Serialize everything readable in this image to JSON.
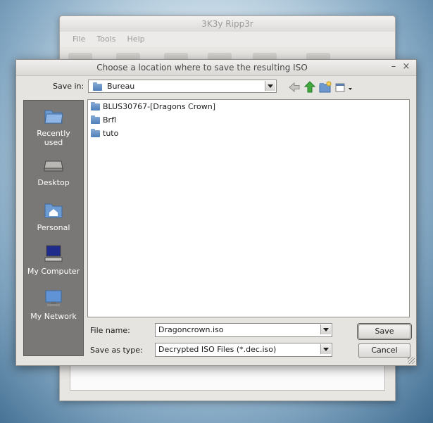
{
  "background_app": {
    "title": "3K3y Ripp3r",
    "menu": [
      "File",
      "Tools",
      "Help"
    ]
  },
  "dialog": {
    "title": "Choose a location where to save the resulting ISO",
    "save_in_label": "Save in:",
    "save_in_value": "Bureau",
    "places": [
      {
        "label": "Recently used",
        "icon": "recent-folder-icon"
      },
      {
        "label": "Desktop",
        "icon": "desktop-icon"
      },
      {
        "label": "Personal",
        "icon": "home-folder-icon"
      },
      {
        "label": "My Computer",
        "icon": "computer-icon"
      },
      {
        "label": "My Network",
        "icon": "network-icon"
      }
    ],
    "files": [
      {
        "name": "BLUS30767-[Dragons Crown]",
        "type": "folder"
      },
      {
        "name": "Brfl",
        "type": "folder"
      },
      {
        "name": "tuto",
        "type": "folder"
      }
    ],
    "file_name_label": "File name:",
    "file_name_value": "Dragoncrown.iso",
    "save_as_type_label": "Save as type:",
    "save_as_type_value": "Decrypted ISO Files (*.dec.iso)",
    "save_label": "Save",
    "cancel_label": "Cancel",
    "minimize_glyph": "–",
    "close_glyph": "×"
  }
}
